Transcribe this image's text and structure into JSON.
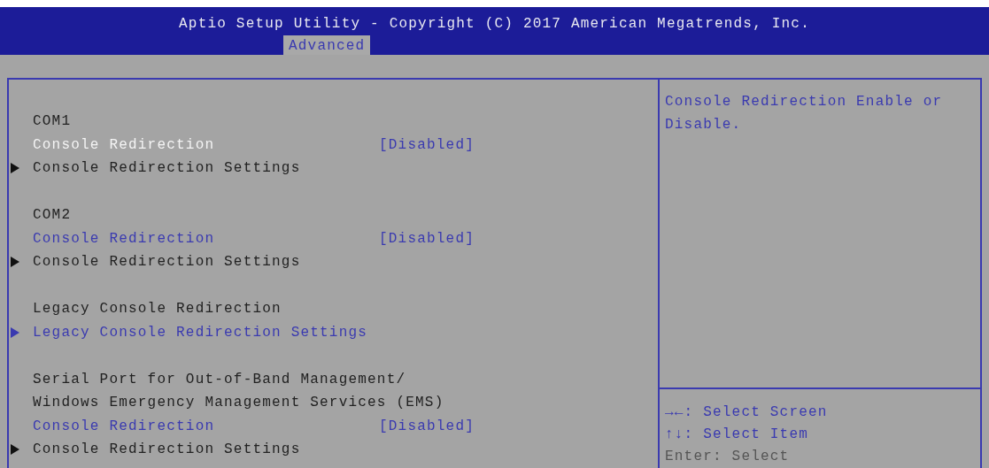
{
  "header": {
    "title": "Aptio Setup Utility - Copyright (C) 2017 American Megatrends, Inc.",
    "tabs": [
      {
        "label": "Advanced",
        "selected": true
      }
    ]
  },
  "menu": [
    {
      "kind": "heading",
      "label": "COM1"
    },
    {
      "kind": "option",
      "label": "Console Redirection",
      "value": "[Disabled]",
      "selected": true
    },
    {
      "kind": "submenu",
      "label": "Console Redirection Settings",
      "disabled": true
    },
    {
      "kind": "heading",
      "label": "COM2"
    },
    {
      "kind": "option",
      "label": "Console Redirection",
      "value": "[Disabled]",
      "selected": false
    },
    {
      "kind": "submenu",
      "label": "Console Redirection Settings",
      "disabled": true
    },
    {
      "kind": "heading",
      "label": "Legacy Console Redirection"
    },
    {
      "kind": "submenu",
      "label": "Legacy Console Redirection Settings",
      "disabled": false
    },
    {
      "kind": "heading",
      "label": "Serial Port for Out-of-Band Management/"
    },
    {
      "kind": "text",
      "label": "Windows Emergency Management Services (EMS)"
    },
    {
      "kind": "option",
      "label": "Console Redirection",
      "value": "[Disabled]",
      "selected": false
    },
    {
      "kind": "submenu",
      "label": "Console Redirection Settings",
      "disabled": true
    }
  ],
  "help": {
    "description": "Console Redirection Enable or Disable.",
    "keys": [
      {
        "label": "→←: Select Screen",
        "highlighted": true
      },
      {
        "label": "↑↓: Select Item",
        "highlighted": true
      },
      {
        "label": "Enter: Select",
        "highlighted": false
      }
    ]
  }
}
